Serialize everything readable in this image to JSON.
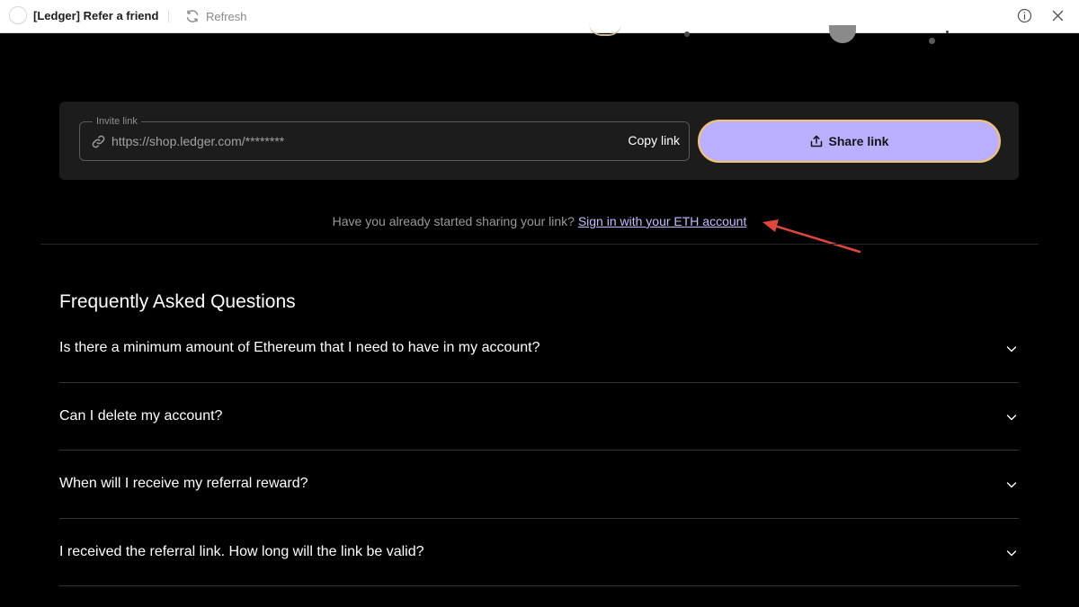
{
  "window": {
    "title": "[Ledger] Refer a friend",
    "refresh_label": "Refresh",
    "icons": {
      "app": "app-logo-icon",
      "refresh": "refresh-icon",
      "info": "info-icon",
      "close": "close-icon"
    }
  },
  "invite": {
    "legend": "Invite link",
    "link_value": "https://shop.ledger.com/********",
    "copy_label": "Copy link",
    "share_label": "Share link",
    "share_icon": "share-icon",
    "link_icon": "link-icon"
  },
  "signin": {
    "prompt": "Have you already started sharing your link?",
    "link_label": "Sign in with your ETH account"
  },
  "faq": {
    "title": "Frequently Asked Questions",
    "items": [
      {
        "question": "Is there a minimum amount of Ethereum that I need to have in my account?"
      },
      {
        "question": "Can I delete my account?"
      },
      {
        "question": "When will I receive my referral reward?"
      },
      {
        "question": "I received the referral link. How long will the link be valid?"
      }
    ]
  },
  "colors": {
    "background": "#000000",
    "card": "#1c1c1c",
    "accent": "#bbb0ff",
    "accent_border": "#f2c36b",
    "link": "#c4baff",
    "annotation_arrow": "#e0473c"
  }
}
